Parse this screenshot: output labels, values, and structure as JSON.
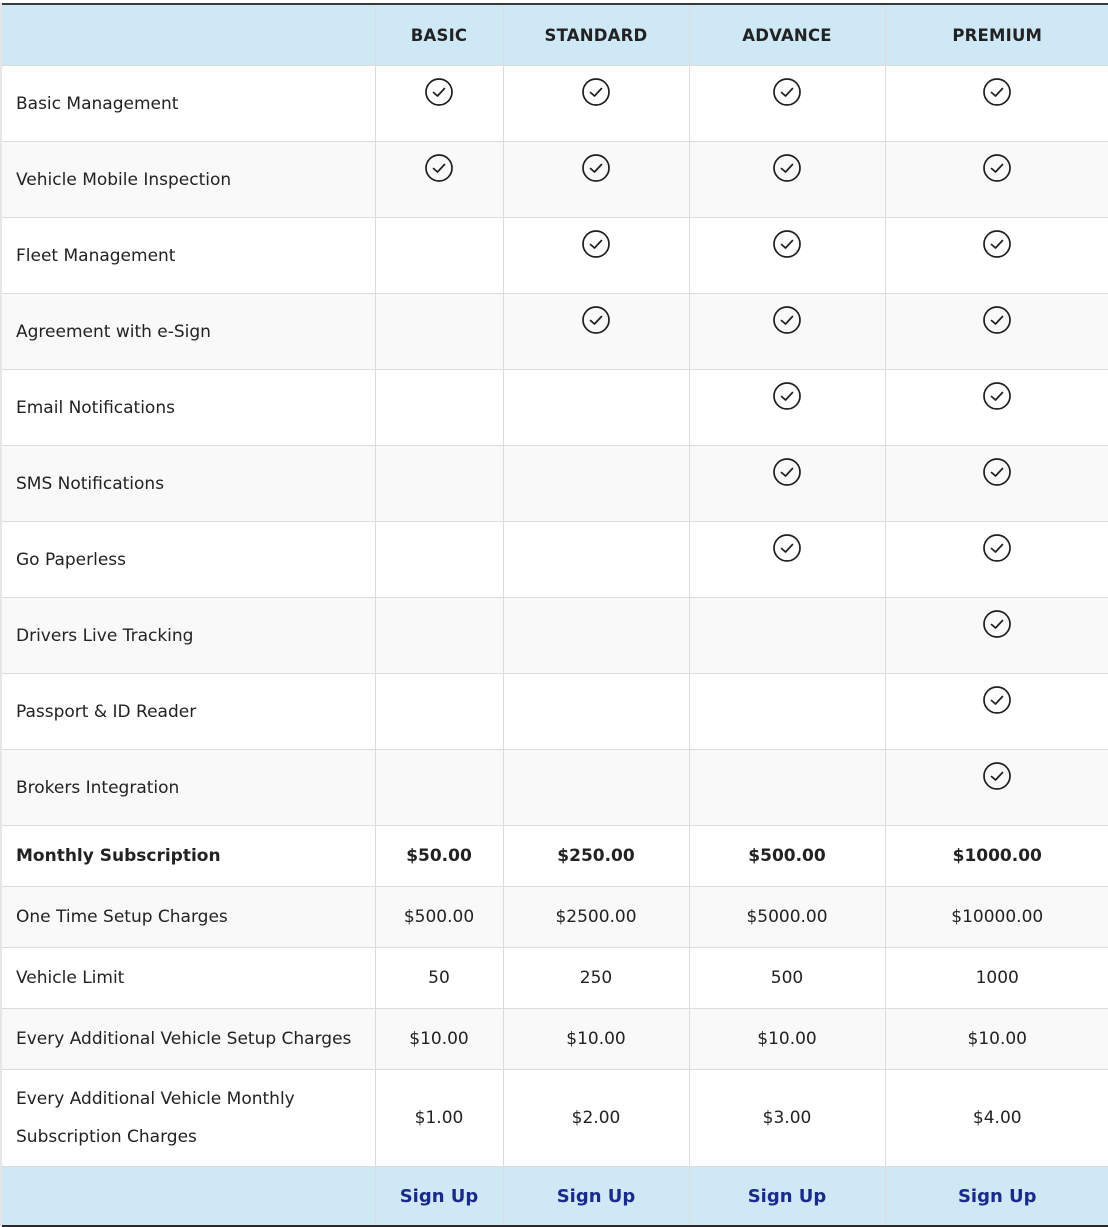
{
  "plans": [
    "BASIC",
    "STANDARD",
    "ADVANCE",
    "PREMIUM"
  ],
  "header_blank": "",
  "features": [
    {
      "name": "Basic Management",
      "included": [
        true,
        true,
        true,
        true
      ]
    },
    {
      "name": "Vehicle Mobile Inspection",
      "included": [
        true,
        true,
        true,
        true
      ]
    },
    {
      "name": "Fleet Management",
      "included": [
        false,
        true,
        true,
        true
      ]
    },
    {
      "name": "Agreement with e-Sign",
      "included": [
        false,
        true,
        true,
        true
      ]
    },
    {
      "name": "Email Notifications",
      "included": [
        false,
        false,
        true,
        true
      ]
    },
    {
      "name": "SMS Notifications",
      "included": [
        false,
        false,
        true,
        true
      ]
    },
    {
      "name": "Go Paperless",
      "included": [
        false,
        false,
        true,
        true
      ]
    },
    {
      "name": "Drivers Live Tracking",
      "included": [
        false,
        false,
        false,
        true
      ]
    },
    {
      "name": "Passport & ID Reader",
      "included": [
        false,
        false,
        false,
        true
      ]
    },
    {
      "name": "Brokers Integration",
      "included": [
        false,
        false,
        false,
        true
      ]
    }
  ],
  "pricing": [
    {
      "name": "Monthly Subscription",
      "bold": true,
      "values": [
        "$50.00",
        "$250.00",
        "$500.00",
        "$1000.00"
      ]
    },
    {
      "name": "One Time Setup Charges",
      "bold": false,
      "values": [
        "$500.00",
        "$2500.00",
        "$5000.00",
        "$10000.00"
      ]
    },
    {
      "name": "Vehicle Limit",
      "bold": false,
      "values": [
        "50",
        "250",
        "500",
        "1000"
      ]
    },
    {
      "name": "Every Additional Vehicle Setup Charges",
      "bold": false,
      "values": [
        "$10.00",
        "$10.00",
        "$10.00",
        "$10.00"
      ]
    },
    {
      "name_lines": [
        "Every Additional Vehicle Monthly",
        "Subscription Charges"
      ],
      "bold": false,
      "values": [
        "$1.00",
        "$2.00",
        "$3.00",
        "$4.00"
      ]
    }
  ],
  "signup_label": "Sign Up",
  "icons": {
    "included": "check-circle-icon"
  },
  "colors": {
    "header_bg": "#cfe8f5",
    "signup_link": "#1b2a8a",
    "row_alt": "#f9f9f9"
  }
}
